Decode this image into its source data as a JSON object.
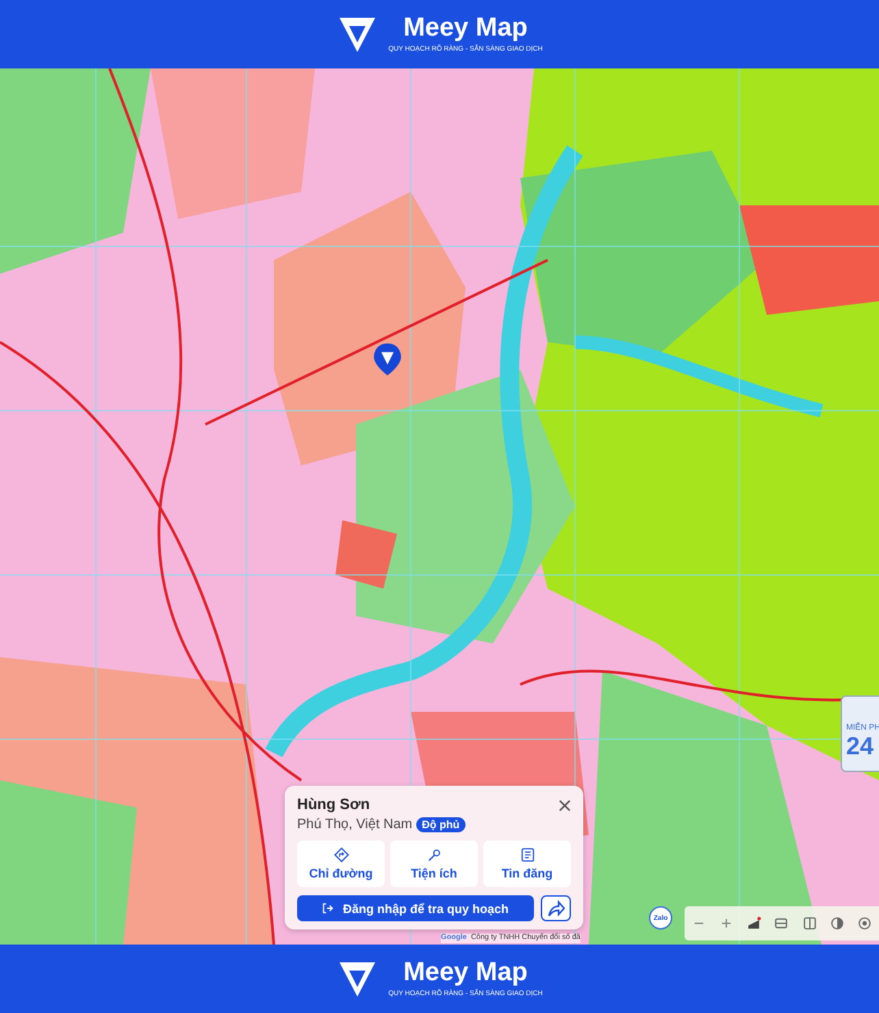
{
  "header": {
    "brand": "Meey Map",
    "tagline": "QUY HOẠCH RÕ RÀNG - SẴN SÀNG GIAO DỊCH"
  },
  "map": {
    "ad": {
      "label": "MIỄN PH",
      "value": "24"
    },
    "zalo": "Zalo",
    "attribution_logo": "Google",
    "attribution": "Công ty TNHH Chuyển đổi số đã"
  },
  "popup": {
    "title": "Hùng Sơn",
    "subtitle": "Phú Thọ, Việt Nam",
    "badge": "Độ phủ",
    "actions": [
      {
        "kind": "directions",
        "label": "Chỉ đường"
      },
      {
        "kind": "utilities",
        "label": "Tiện ích"
      },
      {
        "kind": "listings",
        "label": "Tin đăng"
      }
    ],
    "login_button": "Đăng nhập để tra quy hoạch"
  },
  "footer": {
    "brand": "Meey Map",
    "tagline": "QUY HOẠCH RÕ RÀNG - SẴN SÀNG GIAO DỊCH"
  }
}
